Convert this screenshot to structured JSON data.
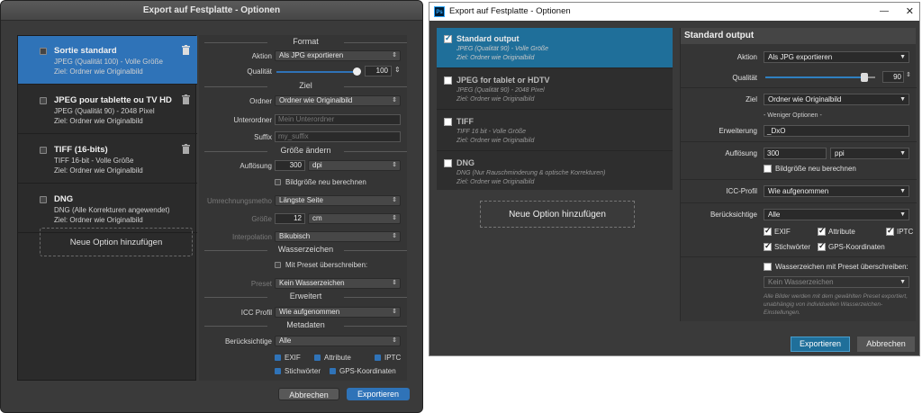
{
  "mac": {
    "title": "Export auf Festplatte - Optionen",
    "options": [
      {
        "title": "Sortie standard",
        "line1": "JPEG (Qualität 100) - Volle Größe",
        "line2": "Ziel: Ordner wie Originalbild"
      },
      {
        "title": "JPEG pour tablette ou TV HD",
        "line1": "JPEG (Qualität 90) - 2048 Pixel",
        "line2": "Ziel: Ordner wie Originalbild"
      },
      {
        "title": "TIFF (16-bits)",
        "line1": "TIFF 16-bit - Volle Größe",
        "line2": "Ziel: Ordner wie Originalbild"
      },
      {
        "title": "DNG",
        "line1": "DNG (Alle Korrekturen angewendet)",
        "line2": "Ziel: Ordner wie Originalbild"
      }
    ],
    "add_option": "Neue Option hinzufügen",
    "sections": {
      "format": "Format",
      "ziel": "Ziel",
      "groesse": "Größe ändern",
      "wasserzeichen": "Wasserzeichen",
      "erweitert": "Erweitert",
      "metadaten": "Metadaten"
    },
    "labels": {
      "aktion": "Aktion",
      "qualitaet": "Qualität",
      "ordner": "Ordner",
      "unterordner": "Unterordner",
      "suffix": "Suffix",
      "aufloesung": "Auflösung",
      "umrechnung": "Umrechnungsmetho",
      "groesse": "Größe",
      "interpolation": "Interpolation",
      "preset": "Preset",
      "icc": "ICC Profil",
      "beruecksichtige": "Berücksichtige"
    },
    "values": {
      "aktion": "Als JPG exportieren",
      "qualitaet": "100",
      "ordner": "Ordner wie Originalbild",
      "unterordner_placeholder": "Mein Unterordner",
      "suffix_placeholder": "my_suffix",
      "aufloesung": "300",
      "aufloesung_unit": "dpi",
      "bildgroesse": "Bildgröße neu berechnen",
      "umrechnung": "Längste Seite",
      "groesse": "12",
      "groesse_unit": "cm",
      "interpolation": "Bikubisch",
      "preset_check": "Mit Preset überschreiben:",
      "preset": "Kein Wasserzeichen",
      "icc": "Wie aufgenommen",
      "beruecksichtige": "Alle",
      "exif": "EXIF",
      "attribute": "Attribute",
      "iptc": "IPTC",
      "stichwoerter": "Stichwörter",
      "gps": "GPS-Koordinaten"
    },
    "buttons": {
      "cancel": "Abbrechen",
      "export": "Exportieren"
    },
    "quality_fraction": 0.97
  },
  "win": {
    "title": "Export auf Festplatte - Optionen",
    "options": [
      {
        "title": "Standard output",
        "line1": "JPEG (Qualität 90) - Volle Größe",
        "line2": "Ziel: Ordner wie Originalbild"
      },
      {
        "title": "JPEG for tablet or HDTV",
        "line1": "JPEG (Qualität 90) - 2048 Pixel",
        "line2": "Ziel: Ordner wie Originalbild"
      },
      {
        "title": "TIFF",
        "line1": "TIFF 16 bit - Volle Größe",
        "line2": "Ziel: Ordner wie Originalbild"
      },
      {
        "title": "DNG",
        "line1": "DNG (Nur Rauschminderung & optische Korrekturen)",
        "line2": "Ziel: Ordner wie Originalbild"
      }
    ],
    "add_option": "Neue Option hinzufügen",
    "panel_title": "Standard output",
    "labels": {
      "aktion": "Aktion",
      "qualitaet": "Qualität",
      "ziel": "Ziel",
      "erweiterung": "Erweiterung",
      "aufloesung": "Auflösung",
      "icc": "ICC-Profil",
      "beruecksichtige": "Berücksichtige"
    },
    "values": {
      "aktion": "Als JPG exportieren",
      "qualitaet": "90",
      "ziel": "Ordner wie Originalbild",
      "weniger": "- Weniger Optionen -",
      "erweiterung": "_DxO",
      "aufloesung": "300",
      "aufloesung_unit": "ppi",
      "bildgroesse": "Bildgröße neu berechnen",
      "icc": "Wie aufgenommen",
      "beruecksichtige": "Alle",
      "exif": "EXIF",
      "attribute": "Attribute",
      "iptc": "IPTC",
      "stichwoerter": "Stichwörter",
      "gps": "GPS-Koordinaten",
      "wasser_check": "Wasserzeichen mit Preset überschreiben:",
      "wasser": "Kein Wasserzeichen",
      "note": "Alle Bilder werden mit dem gewählten Preset exportiert, unabhängig von individuellen Wasserzeichen-Einstellungen."
    },
    "buttons": {
      "export": "Exportieren",
      "cancel": "Abbrechen"
    },
    "quality_fraction": 0.9
  }
}
